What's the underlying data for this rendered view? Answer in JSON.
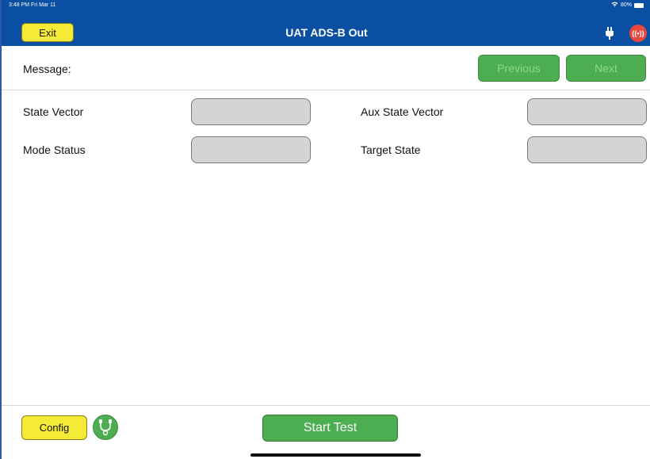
{
  "status_bar": {
    "time": "3:48 PM  Fri Mar 11",
    "battery": "80%"
  },
  "header": {
    "exit_label": "Exit",
    "title": "UAT ADS-B Out",
    "radio_icon_text": "((•))"
  },
  "message": {
    "label": "Message:",
    "previous_label": "Previous",
    "next_label": "Next"
  },
  "fields": {
    "state_vector": {
      "label": "State Vector",
      "value": ""
    },
    "aux_state_vector": {
      "label": "Aux State Vector",
      "value": ""
    },
    "mode_status": {
      "label": "Mode Status",
      "value": ""
    },
    "target_state": {
      "label": "Target State",
      "value": ""
    }
  },
  "footer": {
    "config_label": "Config",
    "start_label": "Start Test"
  },
  "colors": {
    "header_bg": "#0b4fa3",
    "yellow_button": "#f5ea37",
    "green_button": "#4cae50",
    "radio_red": "#e8493c",
    "field_gray": "#d4d4d4"
  },
  "icons": {
    "wifi": "wifi-icon",
    "battery": "battery-icon",
    "plug": "plug-icon",
    "radio": "radio-broadcast-icon",
    "connect": "usb-connection-icon"
  }
}
